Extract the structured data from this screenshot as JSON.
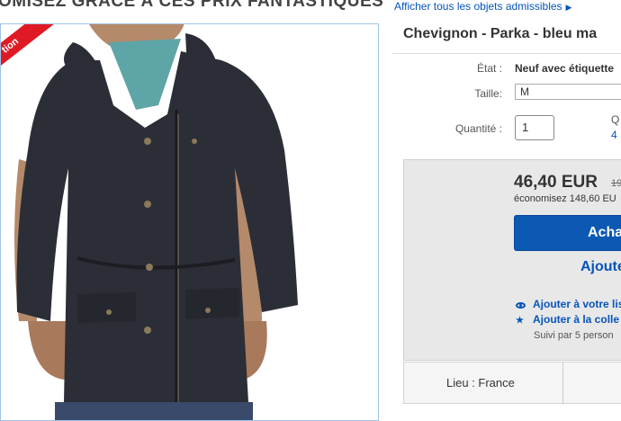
{
  "banner": {
    "title": "OMISEZ GRÂCE À CES PRIX FANTASTIQUES",
    "link": "Afficher tous les objets admissibles",
    "link_arrow": "▶"
  },
  "photo": {
    "ribbon_text": "tion",
    "ribbon_color": "#e01a24"
  },
  "listing": {
    "title": "Chevignon - Parka - bleu ma",
    "condition_label": "État :",
    "condition_value": "Neuf avec étiquette",
    "size_label": "Taille:",
    "size_value": "M",
    "quantity_label": "Quantité :",
    "quantity_value": "1",
    "quantity_avail_line1": "Q",
    "quantity_avail_line2": "4"
  },
  "buybox": {
    "price": "46,40 EUR",
    "old_price": "19",
    "savings": "économisez 148,60 EU",
    "buy_button": "Acha",
    "cart_link": "Ajoute",
    "watch_link": "Ajouter à votre lis",
    "collection_link": "Ajouter à la colle",
    "followers": "Suivi par 5 person",
    "button_color": "#0b59b3",
    "link_color": "#0654ba"
  },
  "location": {
    "text": "Lieu : France"
  }
}
